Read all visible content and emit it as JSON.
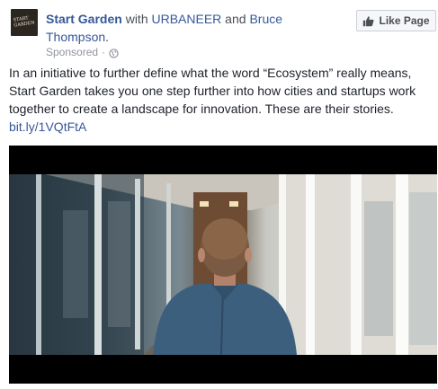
{
  "header": {
    "avatar_text": "START GARDEN",
    "page_name": "Start Garden",
    "with_word": " with ",
    "tagged_1": "URBANEER",
    "and_word": " and ",
    "tagged_2": "Bruce Thompson",
    "period": ".",
    "sponsored": "Sponsored",
    "separator": "·",
    "privacy_icon": "globe-icon"
  },
  "like_button": {
    "label": "Like Page",
    "icon": "thumbs-up-icon"
  },
  "post": {
    "text": "In an initiative to further define what the word “Ecosystem” really means, Start Garden takes you one step further into how cities and startups work together to create a landscape for innovation. These are their stories.",
    "link": "bit.ly/1VQtFtA"
  },
  "colors": {
    "link": "#365899",
    "meta": "#90949c",
    "text": "#1d2129",
    "button_bg": "#f6f7f9",
    "button_border": "#ccd0d5"
  }
}
